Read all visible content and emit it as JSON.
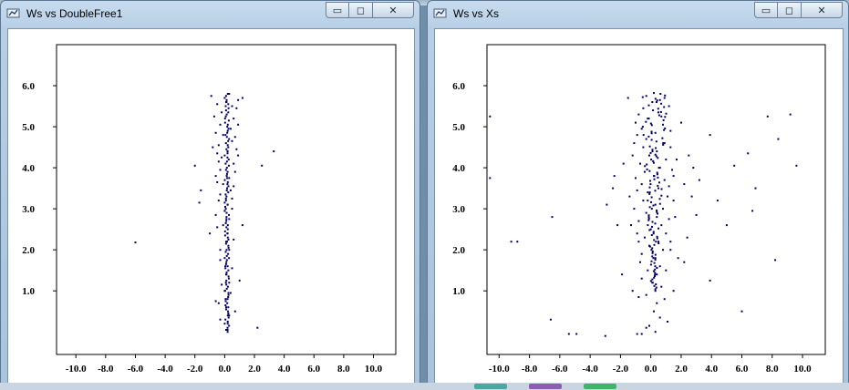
{
  "windows": [
    {
      "id": "w1",
      "title": "Ws vs DoubleFree1",
      "controls": {
        "minimize": "▭",
        "maximize": "◻",
        "close": "✕"
      },
      "chart_data": {
        "type": "scatter",
        "xlim": [
          -11.3,
          11.5
        ],
        "ylim": [
          -0.55,
          7.0
        ],
        "xticks": [
          -10,
          -8,
          -6,
          -4,
          -2,
          0,
          2,
          4,
          6,
          8,
          10
        ],
        "xtick_labels": [
          "-10.0",
          "-8.0",
          "-6.0",
          "-4.0",
          "-2.0",
          "0.0",
          "2.0",
          "4.0",
          "6.0",
          "8.0",
          "10.0"
        ],
        "yticks": [
          1,
          2,
          3,
          4,
          5,
          6
        ],
        "ytick_labels": [
          "1.0",
          "2.0",
          "3.0",
          "4.0",
          "5.0",
          "6.0"
        ],
        "point_color": "#000066",
        "grid": false,
        "points": [
          [
            -6.0,
            2.18
          ],
          [
            -2.0,
            4.05
          ],
          [
            -1.6,
            3.45
          ],
          [
            -1.7,
            3.15
          ],
          [
            -1.0,
            2.4
          ],
          [
            3.3,
            4.4
          ],
          [
            2.5,
            4.05
          ],
          [
            2.2,
            0.1
          ],
          [
            -0.6,
            0.75
          ],
          [
            -0.4,
            0.7
          ],
          [
            1.0,
            1.25
          ],
          [
            0.7,
            0.5
          ],
          [
            1.2,
            2.6
          ],
          [
            -0.5,
            2.55
          ],
          [
            -0.3,
            2.0
          ],
          [
            -0.9,
            5.75
          ],
          [
            0.9,
            5.65
          ],
          [
            1.2,
            5.7
          ],
          [
            -0.8,
            4.5
          ],
          [
            0.9,
            4.3
          ],
          [
            -0.6,
            3.8
          ],
          [
            0.7,
            3.9
          ],
          [
            -0.4,
            3.2
          ],
          [
            0.5,
            3.0
          ],
          [
            0.3,
            5.8
          ],
          [
            0.1,
            5.6
          ],
          [
            0.5,
            5.5
          ],
          [
            -0.2,
            5.35
          ],
          [
            0.6,
            5.2
          ],
          [
            -0.3,
            5.05
          ],
          [
            0.4,
            4.95
          ],
          [
            -0.1,
            4.8
          ],
          [
            0.5,
            4.65
          ],
          [
            -0.4,
            4.55
          ],
          [
            0.2,
            4.4
          ],
          [
            -0.2,
            4.25
          ],
          [
            0.6,
            4.1
          ],
          [
            -0.3,
            3.95
          ],
          [
            0.3,
            3.75
          ],
          [
            -0.1,
            3.6
          ],
          [
            0.4,
            3.45
          ],
          [
            -0.3,
            3.35
          ],
          [
            0.2,
            3.1
          ],
          [
            0.0,
            2.95
          ],
          [
            0.3,
            2.75
          ],
          [
            -0.1,
            2.6
          ],
          [
            0.2,
            2.4
          ],
          [
            0.1,
            2.2
          ],
          [
            0.3,
            2.0
          ],
          [
            0.0,
            1.8
          ],
          [
            0.2,
            1.6
          ],
          [
            0.1,
            1.4
          ],
          [
            0.3,
            1.2
          ],
          [
            0.0,
            1.0
          ],
          [
            0.2,
            0.8
          ],
          [
            0.1,
            0.6
          ],
          [
            0.3,
            0.4
          ],
          [
            0.0,
            0.2
          ],
          [
            0.2,
            0.05
          ],
          [
            -0.5,
            5.55
          ],
          [
            0.8,
            5.45
          ],
          [
            -0.7,
            5.25
          ],
          [
            0.9,
            5.05
          ],
          [
            -0.6,
            4.85
          ],
          [
            0.7,
            4.75
          ],
          [
            -0.5,
            4.35
          ],
          [
            0.8,
            4.45
          ],
          [
            -0.4,
            4.15
          ],
          [
            0.6,
            3.55
          ],
          [
            -0.5,
            3.65
          ],
          [
            0.5,
            3.25
          ],
          [
            -0.6,
            2.85
          ],
          [
            0.6,
            2.25
          ],
          [
            -0.3,
            1.75
          ],
          [
            0.5,
            1.55
          ],
          [
            -0.2,
            1.15
          ],
          [
            0.4,
            0.95
          ],
          [
            -0.3,
            0.3
          ]
        ],
        "column": {
          "x": 0.15,
          "from": 0.0,
          "to": 5.8,
          "step": 0.05,
          "jitter": 0.15
        }
      }
    },
    {
      "id": "w2",
      "title": "Ws vs Xs",
      "controls": {
        "minimize": "▭",
        "maximize": "◻",
        "close": "✕"
      },
      "chart_data": {
        "type": "scatter",
        "xlim": [
          -10.8,
          11.5
        ],
        "ylim": [
          -0.55,
          7.0
        ],
        "xticks": [
          -10,
          -8,
          -6,
          -4,
          -2,
          0,
          2,
          4,
          6,
          8,
          10
        ],
        "xtick_labels": [
          "-10.0",
          "-8.0",
          "-6.0",
          "-4.0",
          "-2.0",
          "0.0",
          "2.0",
          "4.0",
          "6.0",
          "8.0",
          "10.0"
        ],
        "yticks": [
          1,
          2,
          3,
          4,
          5,
          6
        ],
        "ytick_labels": [
          "1.0",
          "2.0",
          "3.0",
          "4.0",
          "5.0",
          "6.0"
        ],
        "point_color": "#000066",
        "grid": false,
        "points": [
          [
            -10.6,
            5.25
          ],
          [
            -10.6,
            3.75
          ],
          [
            -9.2,
            2.2
          ],
          [
            -8.8,
            2.2
          ],
          [
            -6.5,
            2.8
          ],
          [
            -6.6,
            0.3
          ],
          [
            -5.4,
            -0.05
          ],
          [
            -4.9,
            -0.05
          ],
          [
            -3.0,
            -0.1
          ],
          [
            -2.9,
            3.1
          ],
          [
            -2.5,
            3.5
          ],
          [
            -2.4,
            3.8
          ],
          [
            -1.8,
            4.1
          ],
          [
            -1.5,
            5.7
          ],
          [
            -1.9,
            1.4
          ],
          [
            -1.3,
            2.6
          ],
          [
            -1.2,
            1.0
          ],
          [
            -0.8,
            0.85
          ],
          [
            -0.9,
            -0.05
          ],
          [
            -0.6,
            -0.05
          ],
          [
            -0.3,
            0.1
          ],
          [
            1.1,
            0.25
          ],
          [
            1.8,
            1.8
          ],
          [
            2.2,
            1.7
          ],
          [
            3.0,
            2.85
          ],
          [
            3.2,
            3.7
          ],
          [
            2.8,
            4.0
          ],
          [
            3.9,
            4.8
          ],
          [
            4.4,
            3.2
          ],
          [
            5.0,
            2.6
          ],
          [
            5.5,
            4.05
          ],
          [
            6.0,
            0.5
          ],
          [
            6.4,
            4.35
          ],
          [
            6.9,
            3.5
          ],
          [
            6.7,
            2.95
          ],
          [
            7.7,
            5.25
          ],
          [
            8.4,
            4.7
          ],
          [
            8.2,
            1.75
          ],
          [
            9.2,
            5.3
          ],
          [
            9.6,
            4.05
          ],
          [
            3.9,
            1.25
          ],
          [
            1.5,
            1.0
          ],
          [
            -1.0,
            5.1
          ],
          [
            -0.9,
            4.8
          ],
          [
            1.2,
            5.5
          ],
          [
            1.7,
            4.2
          ],
          [
            1.5,
            3.8
          ],
          [
            2.2,
            3.6
          ],
          [
            1.6,
            2.8
          ],
          [
            1.3,
            2.2
          ],
          [
            -1.4,
            3.3
          ],
          [
            -0.9,
            2.4
          ],
          [
            2.0,
            5.1
          ],
          [
            0.9,
            5.7
          ],
          [
            -0.3,
            5.75
          ],
          [
            0.2,
            5.82
          ],
          [
            0.6,
            5.65
          ],
          [
            -0.5,
            5.45
          ],
          [
            0.5,
            5.35
          ],
          [
            -0.2,
            5.2
          ],
          [
            0.8,
            5.05
          ],
          [
            -0.6,
            4.95
          ],
          [
            0.3,
            4.85
          ],
          [
            -0.3,
            4.7
          ],
          [
            0.9,
            4.6
          ],
          [
            -0.5,
            4.5
          ],
          [
            0.4,
            4.4
          ],
          [
            -0.1,
            4.3
          ],
          [
            1.0,
            4.2
          ],
          [
            -0.7,
            4.1
          ],
          [
            0.6,
            4.0
          ],
          [
            -0.4,
            3.9
          ],
          [
            0.2,
            3.8
          ],
          [
            0.9,
            3.7
          ],
          [
            -0.6,
            3.6
          ],
          [
            0.5,
            3.5
          ],
          [
            -0.2,
            3.4
          ],
          [
            1.1,
            3.3
          ],
          [
            -0.5,
            3.2
          ],
          [
            0.3,
            3.1
          ],
          [
            0.8,
            3.0
          ],
          [
            -0.3,
            2.9
          ],
          [
            0.4,
            2.8
          ],
          [
            -0.8,
            2.7
          ],
          [
            0.7,
            2.6
          ],
          [
            0.0,
            2.5
          ],
          [
            1.0,
            2.4
          ],
          [
            -0.4,
            2.3
          ],
          [
            0.5,
            2.2
          ],
          [
            -0.1,
            2.1
          ],
          [
            0.8,
            2.0
          ],
          [
            -0.6,
            1.9
          ],
          [
            0.3,
            1.8
          ],
          [
            0.6,
            1.6
          ],
          [
            -0.2,
            1.5
          ],
          [
            0.4,
            1.4
          ],
          [
            0.1,
            1.2
          ],
          [
            0.7,
            1.1
          ],
          [
            -0.3,
            0.9
          ],
          [
            0.4,
            0.7
          ],
          [
            0.2,
            0.5
          ],
          [
            0.6,
            0.35
          ],
          [
            -0.1,
            0.15
          ],
          [
            0.3,
            0.0
          ],
          [
            0.1,
            5.6
          ],
          [
            0.7,
            5.25
          ],
          [
            -0.8,
            5.3
          ],
          [
            1.3,
            4.9
          ],
          [
            -1.1,
            4.6
          ],
          [
            1.3,
            4.5
          ],
          [
            -1.2,
            4.3
          ],
          [
            1.4,
            3.95
          ],
          [
            -1.0,
            3.75
          ],
          [
            1.2,
            3.55
          ],
          [
            -0.9,
            3.45
          ],
          [
            1.5,
            3.2
          ],
          [
            -1.1,
            3.0
          ],
          [
            1.2,
            2.75
          ],
          [
            -0.8,
            2.2
          ],
          [
            1.3,
            2.0
          ],
          [
            -0.7,
            1.7
          ],
          [
            1.0,
            1.5
          ],
          [
            -0.6,
            1.3
          ],
          [
            0.9,
            0.8
          ],
          [
            2.5,
            4.3
          ],
          [
            2.7,
            3.3
          ],
          [
            -2.2,
            2.6
          ],
          [
            2.4,
            2.3
          ]
        ],
        "cluster": {
          "x": 0.2,
          "from": 1.0,
          "to": 5.8,
          "step": 0.04,
          "jitter": 0.9
        }
      }
    }
  ]
}
